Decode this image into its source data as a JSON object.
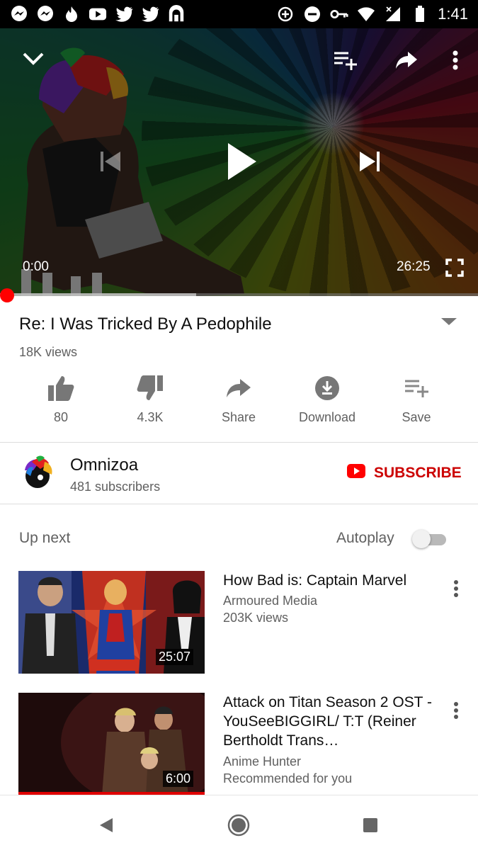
{
  "status_bar": {
    "time": "1:41",
    "left_icons": [
      "messenger-icon",
      "messenger-icon",
      "tinder-icon",
      "youtube-icon",
      "twitter-icon",
      "twitter-icon",
      "eon-icon"
    ],
    "right_icons": [
      "data-saver-icon",
      "do-not-disturb-icon",
      "vpn-key-icon",
      "wifi-icon",
      "signal-icon",
      "battery-icon"
    ]
  },
  "player": {
    "current_time": "0:00",
    "duration": "26:25",
    "progress_fraction": 0.0,
    "buffered_fraction": 0.41
  },
  "video": {
    "title": "Re: I Was Tricked By A Pedophile",
    "views": "18K views"
  },
  "actions": {
    "like_count": "80",
    "dislike_count": "4.3K",
    "share_label": "Share",
    "download_label": "Download",
    "save_label": "Save"
  },
  "channel": {
    "name": "Omnizoa",
    "subscribers": "481 subscribers",
    "subscribe_label": "SUBSCRIBE"
  },
  "up_next": {
    "label": "Up next",
    "autoplay_label": "Autoplay",
    "autoplay_on": false,
    "items": [
      {
        "title": "How Bad is: Captain Marvel",
        "channel": "Armoured Media",
        "meta": "203K views",
        "duration": "25:07"
      },
      {
        "title": "Attack on Titan Season 2 OST - YouSeeBIGGIRL/ T:T (Reiner Bertholdt Trans…",
        "channel": "Anime Hunter",
        "meta": "Recommended for you",
        "duration": "6:00"
      }
    ]
  },
  "colors": {
    "accent_red": "#ff0000",
    "subscribe_red": "#cc0000",
    "secondary_text": "#606060"
  }
}
